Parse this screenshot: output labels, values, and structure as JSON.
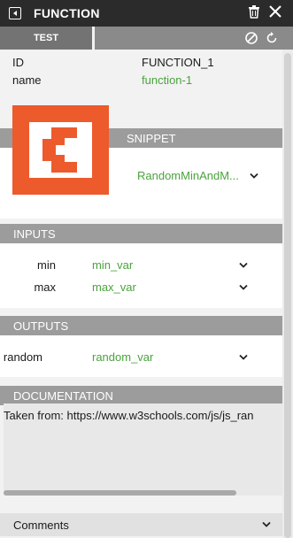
{
  "titlebar": {
    "title": "FUNCTION"
  },
  "tabs": {
    "test_label": "TEST"
  },
  "properties": [
    {
      "label": "ID",
      "value": "FUNCTION_1"
    },
    {
      "label": "name",
      "value": "function-1"
    }
  ],
  "snippet": {
    "header": "SNIPPET",
    "value": "RandomMinAndM..."
  },
  "inputs": {
    "header": "INPUTS",
    "rows": [
      {
        "label": "min",
        "value": "min_var"
      },
      {
        "label": "max",
        "value": "max_var"
      }
    ]
  },
  "outputs": {
    "header": "OUTPUTS",
    "rows": [
      {
        "label": "random",
        "value": "random_var"
      }
    ]
  },
  "documentation": {
    "header": "DOCUMENTATION",
    "text": "Taken from: https://www.w3schools.com/js/js_ran"
  },
  "comments": {
    "label": "Comments"
  },
  "colors": {
    "accent_orange": "#ed5a2c",
    "value_green": "#4aa33d",
    "titlebar": "#2b2b2b",
    "section_header": "#9c9c9c"
  },
  "icons": [
    "back-icon",
    "trash-icon",
    "close-icon",
    "cancel-circle-icon",
    "refresh-icon",
    "chevron-down-icon",
    "function-logo"
  ]
}
